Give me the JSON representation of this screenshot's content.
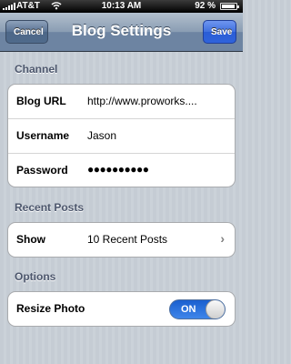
{
  "status_bar": {
    "carrier": "AT&T",
    "time": "10:13 AM",
    "battery": "92 %",
    "wifi_icon": "wifi-icon",
    "battery_icon": "battery-icon"
  },
  "nav": {
    "title": "Blog Settings",
    "cancel_label": "Cancel",
    "save_label": "Save"
  },
  "sections": {
    "channel": {
      "header": "Channel",
      "rows": [
        {
          "label": "Blog URL",
          "value": "http://www.proworks...."
        },
        {
          "label": "Username",
          "value": "Jason"
        },
        {
          "label": "Password",
          "value": "●●●●●●●●●●"
        }
      ]
    },
    "recent_posts": {
      "header": "Recent Posts",
      "rows": [
        {
          "label": "Show",
          "value": "10 Recent Posts"
        }
      ]
    },
    "options": {
      "header": "Options",
      "rows": [
        {
          "label": "Resize Photo",
          "toggle_text": "ON",
          "toggle_on": true
        }
      ]
    }
  },
  "colors": {
    "nav_bg": "#6d84a2",
    "save_button": "#2f63db",
    "toggle_on": "#3f86ea",
    "section_header": "#4c566c"
  }
}
